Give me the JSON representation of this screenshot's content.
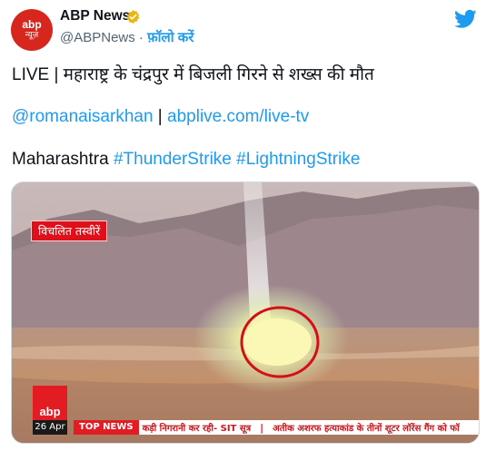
{
  "account": {
    "avatar_line1": "abp",
    "avatar_line2": "न्यूज़",
    "display_name": "ABP News",
    "handle": "@ABPNews",
    "dot": "·",
    "follow_label": "फ़ॉलो करें"
  },
  "tweet": {
    "title": "LIVE | महाराष्ट्र के चंद्रपुर में बिजली गिरने से शख्स की मौत",
    "mention": "@romanaisarkhan",
    "link_separator": " | ",
    "link": "abplive.com/live-tv",
    "tag_prefix": "Maharashtra ",
    "hashtag1": "#ThunderStrike",
    "hashtag2": "#LightningStrike"
  },
  "media": {
    "caption_badge": "विचलित तस्वीरें",
    "channel_logo": "abp",
    "date": "26 Apr",
    "ticker_label": "TOP NEWS",
    "ticker_item1": "कड़ी निगरानी कर रही- SIT सूत्र",
    "ticker_sep": "|",
    "ticker_item2": "अतीक अशरफ हत्याकांड के तीनों शूटर लॉरेंस गैंग को फॉ"
  },
  "colors": {
    "link": "#1d9bf0",
    "brand_red": "#e31b23",
    "verified": "#e8b512"
  },
  "icons": {
    "verified": "verified-badge-icon",
    "platform": "twitter-bird-icon"
  }
}
